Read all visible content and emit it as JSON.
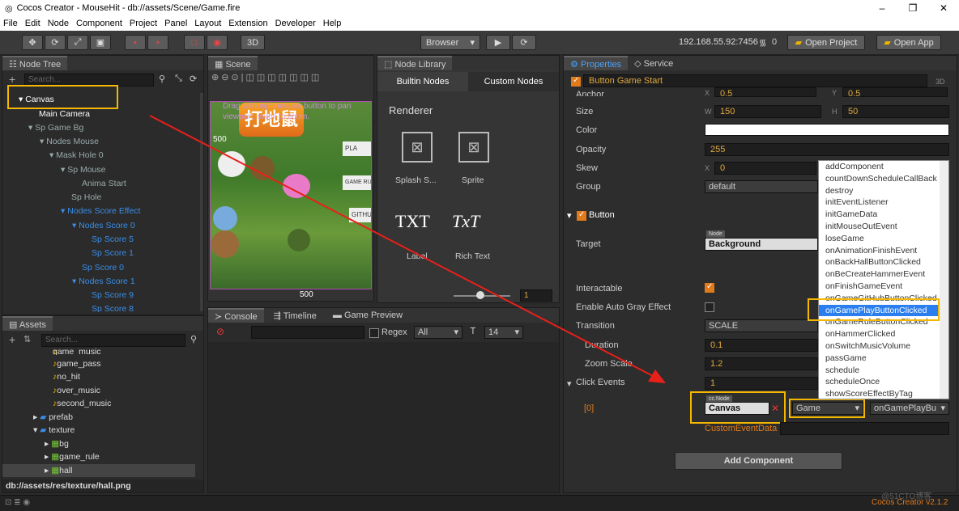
{
  "window": {
    "title": "Cocos Creator - MouseHit - db://assets/Scene/Game.fire",
    "min": "–",
    "max": "❐",
    "close": "✕"
  },
  "menu": [
    "File",
    "Edit",
    "Node",
    "Component",
    "Project",
    "Panel",
    "Layout",
    "Extension",
    "Developer",
    "Help"
  ],
  "toolbar": {
    "btn3d": "3D",
    "browser": "Browser",
    "ip": "192.168.55.92:7456",
    "wifi_count": "0",
    "open_project": "Open Project",
    "open_app": "Open App"
  },
  "node_tree": {
    "title": "Node Tree",
    "search_placeholder": "Search...",
    "items": [
      "Canvas",
      "Main Camera",
      "Sp Game Bg",
      "Nodes Mouse",
      "Mask Hole 0",
      "Sp Mouse",
      "Anima Start",
      "Sp Hole",
      "Nodes Score Effect",
      "Nodes Score 0",
      "Sp Score 5",
      "Sp Score 1",
      "Sp Score 0",
      "Nodes Score 1",
      "Sp Score 9",
      "Sp Score 8"
    ]
  },
  "scene": {
    "title": "Scene",
    "hint": "Drag with right mouse button to pan viewport, scroll to zoom.",
    "tick_500a": "500",
    "tick_500b": "500",
    "btn_play": "PLA",
    "btn_rule": "GAME RU",
    "btn_github": "GITHU"
  },
  "node_library": {
    "title": "Node Library",
    "tab_builtin": "Builtin Nodes",
    "tab_custom": "Custom Nodes",
    "section": "Renderer",
    "items": [
      "Splash S...",
      "Sprite",
      "Label",
      "Rich Text"
    ],
    "label_glyph": "TXT",
    "richtext_glyph": "TxT",
    "zoom_value": "1"
  },
  "assets": {
    "title": "Assets",
    "search_placeholder": "Search...",
    "items": [
      "game_music",
      "game_pass",
      "no_hit",
      "over_music",
      "second_music",
      "prefab",
      "texture",
      "bg",
      "game_rule",
      "hall"
    ],
    "path": "db://assets/res/texture/hall.png"
  },
  "console": {
    "tab_console": "Console",
    "tab_timeline": "Timeline",
    "tab_preview": "Game Preview",
    "regex": "Regex",
    "filter": "All",
    "fontsize": "14"
  },
  "properties": {
    "tab": "Properties",
    "tab_service": "Service",
    "node_name": "Button Game Start",
    "tag3d": "3D",
    "anchor_label": "Anchor",
    "anchor_x": "0.5",
    "anchor_y": "0.5",
    "size_label": "Size",
    "w": "150",
    "h": "50",
    "w_label": "W",
    "h_label": "H",
    "x_label": "X",
    "y_label": "Y",
    "color_label": "Color",
    "opacity_label": "Opacity",
    "opacity": "255",
    "skew_label": "Skew",
    "skew_x": "0",
    "group_label": "Group",
    "group": "default",
    "button_section": "Button",
    "target_label": "Target",
    "node_tag": "Node",
    "target": "Background",
    "interactable_label": "Interactable",
    "autogray_label": "Enable Auto Gray Effect",
    "transition_label": "Transition",
    "transition": "SCALE",
    "duration_label": "Duration",
    "duration": "0.1",
    "zoom_label": "Zoom Scale",
    "zoom": "1.2",
    "click_label": "Click Events",
    "click_count": "1",
    "idx": "[0]",
    "ccnode_tag": "cc.Node",
    "event_target": "Canvas",
    "component": "Game",
    "handler": "onGamePlayBu",
    "custom_label": "CustomEventData",
    "add_component": "Add Component"
  },
  "dropdown": [
    "addComponent",
    "countDownScheduleCallBack",
    "destroy",
    "initEventListener",
    "initGameData",
    "initMouseOutEvent",
    "loseGame",
    "onAnimationFinishEvent",
    "onBackHallButtonClicked",
    "onBeCreateHammerEvent",
    "onFinishGameEvent",
    "onGameGitHubButtonClicked",
    "onGamePlayButtonClicked",
    "onGameRuleButtonClicked",
    "onHammerClicked",
    "onSwitchMusicVolume",
    "passGame",
    "schedule",
    "scheduleOnce",
    "showScoreEffectByTag"
  ],
  "dropdown_selected": "onGamePlayButtonClicked",
  "status": {
    "version": "Cocos Creator v2.1.2",
    "watermark": "@51CTO博客"
  },
  "colors": {
    "accent": "#e07a1a",
    "highlight": "#f5b800",
    "arrow": "#e8201a",
    "selection": "#2a7ef0"
  }
}
